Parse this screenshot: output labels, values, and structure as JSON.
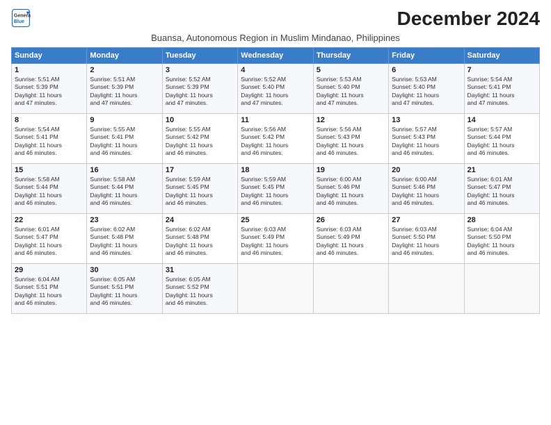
{
  "logo": {
    "line1": "General",
    "line2": "Blue"
  },
  "title": "December 2024",
  "subtitle": "Buansa, Autonomous Region in Muslim Mindanao, Philippines",
  "days_header": [
    "Sunday",
    "Monday",
    "Tuesday",
    "Wednesday",
    "Thursday",
    "Friday",
    "Saturday"
  ],
  "weeks": [
    [
      {
        "num": "1",
        "lines": [
          "Sunrise: 5:51 AM",
          "Sunset: 5:39 PM",
          "Daylight: 11 hours",
          "and 47 minutes."
        ]
      },
      {
        "num": "2",
        "lines": [
          "Sunrise: 5:51 AM",
          "Sunset: 5:39 PM",
          "Daylight: 11 hours",
          "and 47 minutes."
        ]
      },
      {
        "num": "3",
        "lines": [
          "Sunrise: 5:52 AM",
          "Sunset: 5:39 PM",
          "Daylight: 11 hours",
          "and 47 minutes."
        ]
      },
      {
        "num": "4",
        "lines": [
          "Sunrise: 5:52 AM",
          "Sunset: 5:40 PM",
          "Daylight: 11 hours",
          "and 47 minutes."
        ]
      },
      {
        "num": "5",
        "lines": [
          "Sunrise: 5:53 AM",
          "Sunset: 5:40 PM",
          "Daylight: 11 hours",
          "and 47 minutes."
        ]
      },
      {
        "num": "6",
        "lines": [
          "Sunrise: 5:53 AM",
          "Sunset: 5:40 PM",
          "Daylight: 11 hours",
          "and 47 minutes."
        ]
      },
      {
        "num": "7",
        "lines": [
          "Sunrise: 5:54 AM",
          "Sunset: 5:41 PM",
          "Daylight: 11 hours",
          "and 47 minutes."
        ]
      }
    ],
    [
      {
        "num": "8",
        "lines": [
          "Sunrise: 5:54 AM",
          "Sunset: 5:41 PM",
          "Daylight: 11 hours",
          "and 46 minutes."
        ]
      },
      {
        "num": "9",
        "lines": [
          "Sunrise: 5:55 AM",
          "Sunset: 5:41 PM",
          "Daylight: 11 hours",
          "and 46 minutes."
        ]
      },
      {
        "num": "10",
        "lines": [
          "Sunrise: 5:55 AM",
          "Sunset: 5:42 PM",
          "Daylight: 11 hours",
          "and 46 minutes."
        ]
      },
      {
        "num": "11",
        "lines": [
          "Sunrise: 5:56 AM",
          "Sunset: 5:42 PM",
          "Daylight: 11 hours",
          "and 46 minutes."
        ]
      },
      {
        "num": "12",
        "lines": [
          "Sunrise: 5:56 AM",
          "Sunset: 5:43 PM",
          "Daylight: 11 hours",
          "and 46 minutes."
        ]
      },
      {
        "num": "13",
        "lines": [
          "Sunrise: 5:57 AM",
          "Sunset: 5:43 PM",
          "Daylight: 11 hours",
          "and 46 minutes."
        ]
      },
      {
        "num": "14",
        "lines": [
          "Sunrise: 5:57 AM",
          "Sunset: 5:44 PM",
          "Daylight: 11 hours",
          "and 46 minutes."
        ]
      }
    ],
    [
      {
        "num": "15",
        "lines": [
          "Sunrise: 5:58 AM",
          "Sunset: 5:44 PM",
          "Daylight: 11 hours",
          "and 46 minutes."
        ]
      },
      {
        "num": "16",
        "lines": [
          "Sunrise: 5:58 AM",
          "Sunset: 5:44 PM",
          "Daylight: 11 hours",
          "and 46 minutes."
        ]
      },
      {
        "num": "17",
        "lines": [
          "Sunrise: 5:59 AM",
          "Sunset: 5:45 PM",
          "Daylight: 11 hours",
          "and 46 minutes."
        ]
      },
      {
        "num": "18",
        "lines": [
          "Sunrise: 5:59 AM",
          "Sunset: 5:45 PM",
          "Daylight: 11 hours",
          "and 46 minutes."
        ]
      },
      {
        "num": "19",
        "lines": [
          "Sunrise: 6:00 AM",
          "Sunset: 5:46 PM",
          "Daylight: 11 hours",
          "and 46 minutes."
        ]
      },
      {
        "num": "20",
        "lines": [
          "Sunrise: 6:00 AM",
          "Sunset: 5:46 PM",
          "Daylight: 11 hours",
          "and 46 minutes."
        ]
      },
      {
        "num": "21",
        "lines": [
          "Sunrise: 6:01 AM",
          "Sunset: 5:47 PM",
          "Daylight: 11 hours",
          "and 46 minutes."
        ]
      }
    ],
    [
      {
        "num": "22",
        "lines": [
          "Sunrise: 6:01 AM",
          "Sunset: 5:47 PM",
          "Daylight: 11 hours",
          "and 46 minutes."
        ]
      },
      {
        "num": "23",
        "lines": [
          "Sunrise: 6:02 AM",
          "Sunset: 5:48 PM",
          "Daylight: 11 hours",
          "and 46 minutes."
        ]
      },
      {
        "num": "24",
        "lines": [
          "Sunrise: 6:02 AM",
          "Sunset: 5:48 PM",
          "Daylight: 11 hours",
          "and 46 minutes."
        ]
      },
      {
        "num": "25",
        "lines": [
          "Sunrise: 6:03 AM",
          "Sunset: 5:49 PM",
          "Daylight: 11 hours",
          "and 46 minutes."
        ]
      },
      {
        "num": "26",
        "lines": [
          "Sunrise: 6:03 AM",
          "Sunset: 5:49 PM",
          "Daylight: 11 hours",
          "and 46 minutes."
        ]
      },
      {
        "num": "27",
        "lines": [
          "Sunrise: 6:03 AM",
          "Sunset: 5:50 PM",
          "Daylight: 11 hours",
          "and 46 minutes."
        ]
      },
      {
        "num": "28",
        "lines": [
          "Sunrise: 6:04 AM",
          "Sunset: 5:50 PM",
          "Daylight: 11 hours",
          "and 46 minutes."
        ]
      }
    ],
    [
      {
        "num": "29",
        "lines": [
          "Sunrise: 6:04 AM",
          "Sunset: 5:51 PM",
          "Daylight: 11 hours",
          "and 46 minutes."
        ]
      },
      {
        "num": "30",
        "lines": [
          "Sunrise: 6:05 AM",
          "Sunset: 5:51 PM",
          "Daylight: 11 hours",
          "and 46 minutes."
        ]
      },
      {
        "num": "31",
        "lines": [
          "Sunrise: 6:05 AM",
          "Sunset: 5:52 PM",
          "Daylight: 11 hours",
          "and 46 minutes."
        ]
      },
      null,
      null,
      null,
      null
    ]
  ]
}
